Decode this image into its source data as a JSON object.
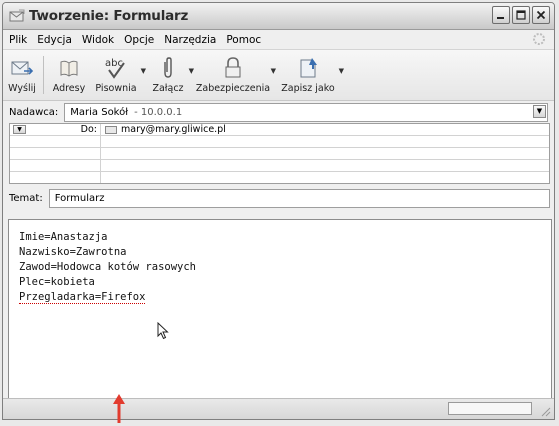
{
  "window": {
    "title": "Tworzenie: Formularz"
  },
  "menu": {
    "items": [
      "Plik",
      "Edycja",
      "Widok",
      "Opcje",
      "Narzędzia",
      "Pomoc"
    ]
  },
  "toolbar": {
    "send": "Wyślij",
    "addresses": "Adresy",
    "spelling": "Pisownia",
    "attach": "Załącz",
    "security": "Zabezpieczenia",
    "save_as": "Zapisz jako",
    "spelling_icon_text": "abc"
  },
  "sender": {
    "label": "Nadawca:",
    "name": "Maria Sokół",
    "ip": "- 10.0.0.1"
  },
  "recipients": {
    "type": "Do:",
    "address": "mary@mary.gliwice.pl"
  },
  "subject": {
    "label": "Temat:",
    "value": "Formularz"
  },
  "body": {
    "lines": [
      "Imie=Anastazja",
      "Nazwisko=Zawrotna",
      "Zawod=Hodowca kotów rasowych",
      "Plec=kobieta",
      "Przegladarka=Firefox"
    ]
  },
  "colors": {
    "annotation_arrow": "#e23b2e"
  }
}
